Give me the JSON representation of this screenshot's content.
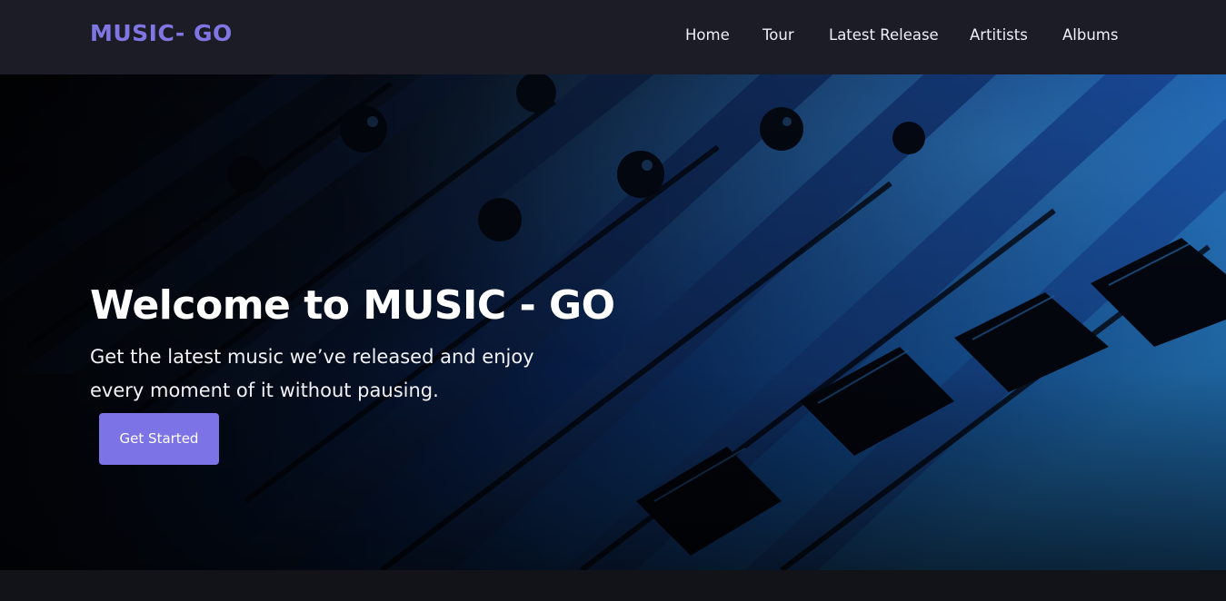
{
  "header": {
    "brand": "MUSIC- GO",
    "nav": [
      {
        "label": "Home"
      },
      {
        "label": "Tour"
      },
      {
        "label": "Latest Release"
      },
      {
        "label": "Artitists"
      },
      {
        "label": "Albums"
      }
    ]
  },
  "hero": {
    "title": "Welcome to MUSIC - GO",
    "subtitle": "Get the latest music we’ve released and enjoy every moment of it without pausing.",
    "cta_label": "Get Started",
    "background_icon": "audio-mixer-image"
  },
  "colors": {
    "header_bg": "#1b1c26",
    "brand": "#7f76e3",
    "button": "#7c73e6",
    "page_bg": "#121319"
  }
}
